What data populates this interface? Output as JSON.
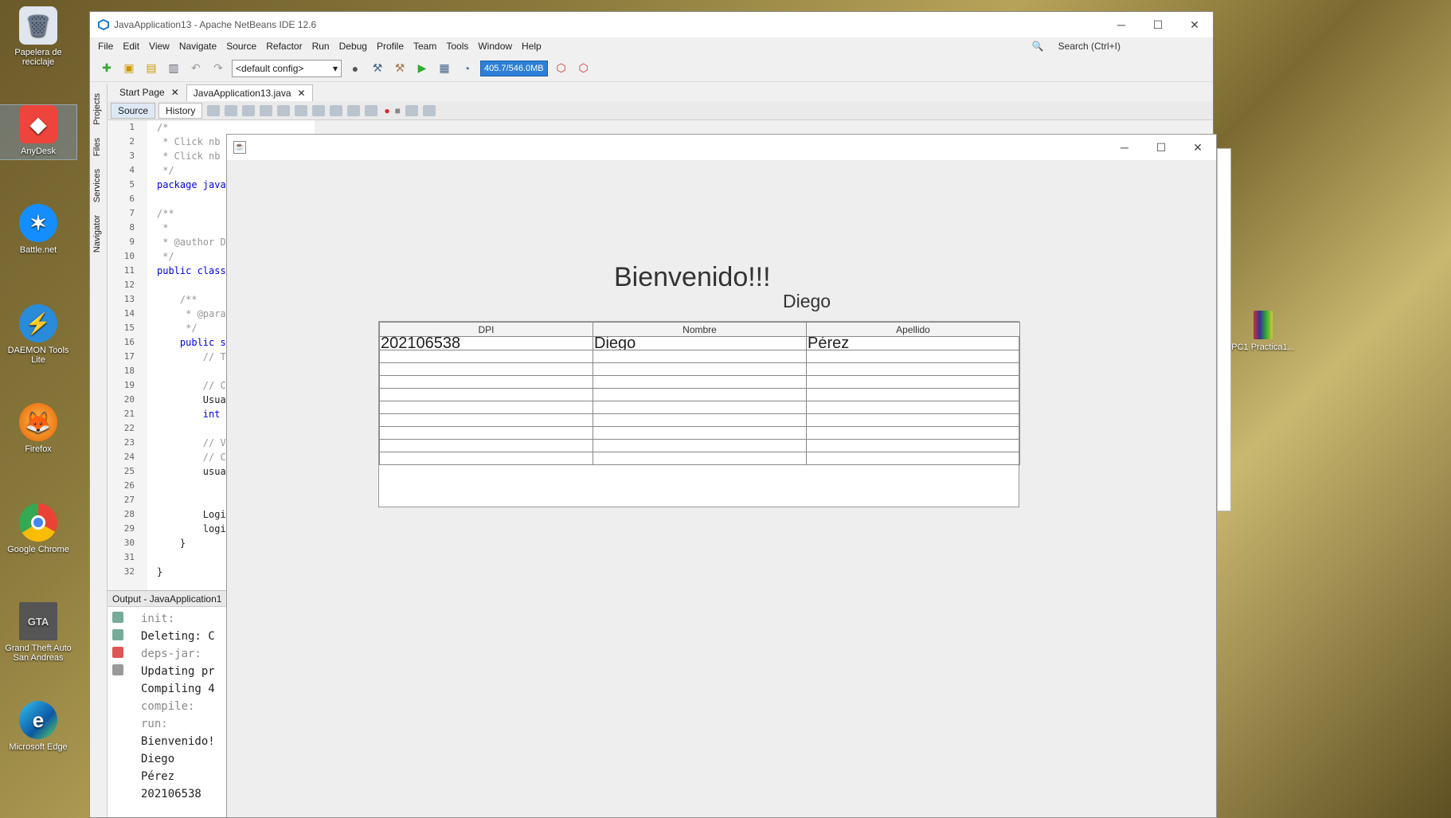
{
  "desktop": {
    "icons": [
      {
        "label": "Papelera de reciclaje",
        "icon": "recycle-bin-icon"
      },
      {
        "label": "AnyDesk",
        "icon": "anydesk-icon"
      },
      {
        "label": "Battle.net",
        "icon": "battlenet-icon"
      },
      {
        "label": "DAEMON Tools Lite",
        "icon": "daemon-tools-icon"
      },
      {
        "label": "Firefox",
        "icon": "firefox-icon"
      },
      {
        "label": "Google Chrome",
        "icon": "chrome-icon"
      },
      {
        "label": "Grand Theft Auto San Andreas",
        "icon": "gta-icon"
      },
      {
        "label": "Microsoft Edge",
        "icon": "edge-icon"
      },
      {
        "label": "PC1 Practica1...",
        "icon": "archive-icon"
      }
    ]
  },
  "netbeans": {
    "title": "JavaApplication13 - Apache NetBeans IDE 12.6",
    "menu": [
      "File",
      "Edit",
      "View",
      "Navigate",
      "Source",
      "Refactor",
      "Run",
      "Debug",
      "Profile",
      "Team",
      "Tools",
      "Window",
      "Help"
    ],
    "search_placeholder": "Search (Ctrl+I)",
    "config": "<default config>",
    "memory": "405.7/546.0MB",
    "side_tabs": [
      "Projects",
      "Files",
      "Services",
      "Navigator"
    ],
    "editor_tabs": [
      {
        "label": "Start Page"
      },
      {
        "label": "JavaApplication13.java"
      }
    ],
    "source_tab": "Source",
    "history_tab": "History",
    "line_numbers": [
      "1",
      "2",
      "3",
      "4",
      "5",
      "6",
      "7",
      "8",
      "9",
      "10",
      "11",
      "12",
      "13",
      "14",
      "15",
      "16",
      "17",
      "18",
      "19",
      "20",
      "21",
      "22",
      "23",
      "24",
      "25",
      "26",
      "27",
      "28",
      "29",
      "30",
      "31",
      "32"
    ],
    "code_lines": [
      "/*",
      " * Click nb",
      " * Click nb",
      " */",
      "package java",
      "",
      "/**",
      " *",
      " * @author D",
      " */",
      "public class",
      "",
      "    /**",
      "     * @para",
      "     */",
      "    public s",
      "        // T",
      "",
      "        // C",
      "        Usua",
      "        int",
      "",
      "        // V",
      "        // C",
      "        usua",
      "",
      "",
      "        Logi",
      "        logi",
      "    }",
      "",
      "}"
    ],
    "output": {
      "title": "Output - JavaApplication1",
      "lines": [
        "init:",
        "Deleting: C",
        "deps-jar:",
        "Updating pr",
        "Compiling 4",
        "compile:",
        "run:",
        "Bienvenido!",
        "Diego",
        "Pérez",
        "202106538"
      ]
    }
  },
  "jframe": {
    "welcome": "Bienvenido!!!",
    "user_name": "Diego",
    "columns": [
      "DPI",
      "Nombre",
      "Apellido"
    ],
    "rows": [
      [
        "202106538",
        "Diego",
        "Pérez"
      ],
      [
        "",
        "",
        ""
      ],
      [
        "",
        "",
        ""
      ],
      [
        "",
        "",
        ""
      ],
      [
        "",
        "",
        ""
      ],
      [
        "",
        "",
        ""
      ],
      [
        "",
        "",
        ""
      ],
      [
        "",
        "",
        ""
      ],
      [
        "",
        "",
        ""
      ],
      [
        "",
        "",
        ""
      ]
    ]
  }
}
